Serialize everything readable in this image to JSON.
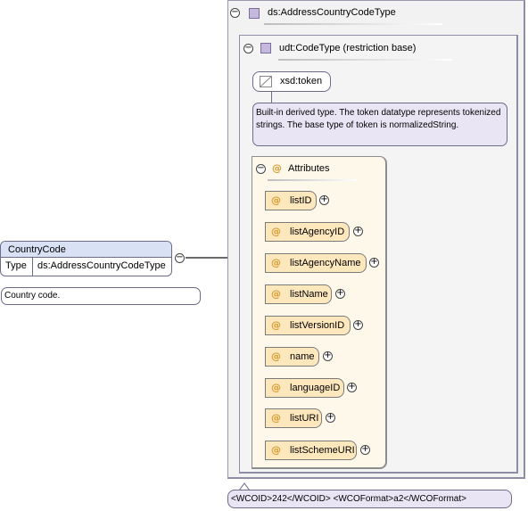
{
  "element": {
    "name": "CountryCode",
    "type_key": "Type",
    "type_value": "ds:AddressCountryCodeType",
    "documentation": "Country code."
  },
  "outer_type": {
    "title": "ds:AddressCountryCodeType"
  },
  "restriction": {
    "title": "udt:CodeType (restriction base)",
    "base_token": "xsd:token",
    "documentation": "Built-in derived type. The token datatype represents tokenized strings. The base type of token is normalizedString."
  },
  "attributes": {
    "title": "Attributes",
    "items": [
      {
        "label": "listID"
      },
      {
        "label": "listAgencyID"
      },
      {
        "label": "listAgencyName"
      },
      {
        "label": "listName"
      },
      {
        "label": "listVersionID"
      },
      {
        "label": "name"
      },
      {
        "label": "languageID"
      },
      {
        "label": "listURI"
      },
      {
        "label": "listSchemeURI"
      }
    ]
  },
  "appinfo": "<WCOID>242</WCOID> <WCOFormat>a2</WCOFormat>",
  "icons": {
    "collapse": "minus-circle-icon",
    "expand": "plus-circle-icon",
    "attribute": "at-sign-icon",
    "simple_type": "type-square-icon"
  }
}
